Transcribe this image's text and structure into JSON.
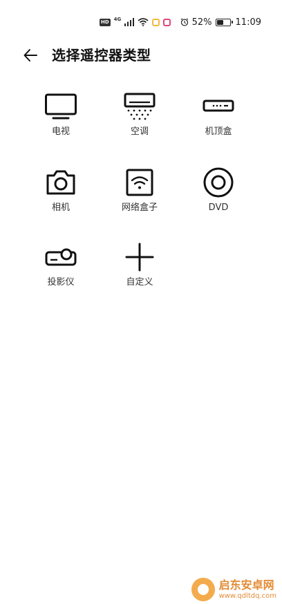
{
  "status_bar": {
    "hd_badge": "HD",
    "network_label": "4G",
    "battery_percent_text": "52%",
    "battery_level": 0.52,
    "time": "11:09",
    "icons": [
      "hd-badge-icon",
      "signal-icon",
      "wifi-icon",
      "app-notification-icon",
      "calendar-notification-icon",
      "alarm-icon",
      "battery-icon"
    ],
    "colors": {
      "notify_yellow": "#f5b940",
      "notify_red": "#e0457b"
    }
  },
  "header": {
    "title": "选择遥控器类型",
    "back_icon": "arrow-left-icon"
  },
  "devices": [
    {
      "id": "tv",
      "label": "电视",
      "icon": "tv-icon"
    },
    {
      "id": "aircon",
      "label": "空调",
      "icon": "air-conditioner-icon"
    },
    {
      "id": "settop",
      "label": "机顶盒",
      "icon": "set-top-box-icon"
    },
    {
      "id": "camera",
      "label": "相机",
      "icon": "camera-icon"
    },
    {
      "id": "netbox",
      "label": "网络盒子",
      "icon": "network-box-icon"
    },
    {
      "id": "dvd",
      "label": "DVD",
      "icon": "disc-icon"
    },
    {
      "id": "projector",
      "label": "投影仪",
      "icon": "projector-icon"
    },
    {
      "id": "custom",
      "label": "自定义",
      "icon": "plus-icon"
    }
  ],
  "watermark": {
    "title": "启东安卓网",
    "url": "www.qdltdq.com"
  }
}
